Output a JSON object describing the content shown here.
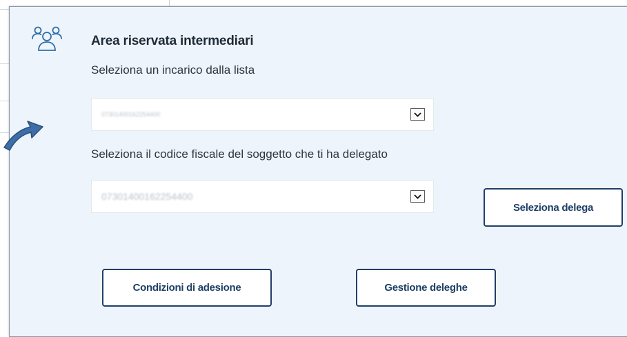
{
  "panel": {
    "icon": "users-group-icon",
    "title": "Area riservata intermediari",
    "incarico_label": "Seleziona un incarico dalla lista",
    "incarico_value": "07301400162254400",
    "codice_label": "Seleziona il codice fiscale del soggetto che ti ha delegato",
    "codice_value": "07301400162254400",
    "select_button": "Seleziona delega",
    "conditions_button": "Condizioni di adesione",
    "manage_button": "Gestione deleghe"
  },
  "colors": {
    "panel_bg": "#eef4fb",
    "button_text": "#1f3f66",
    "arrow": "#3e6ea8"
  }
}
